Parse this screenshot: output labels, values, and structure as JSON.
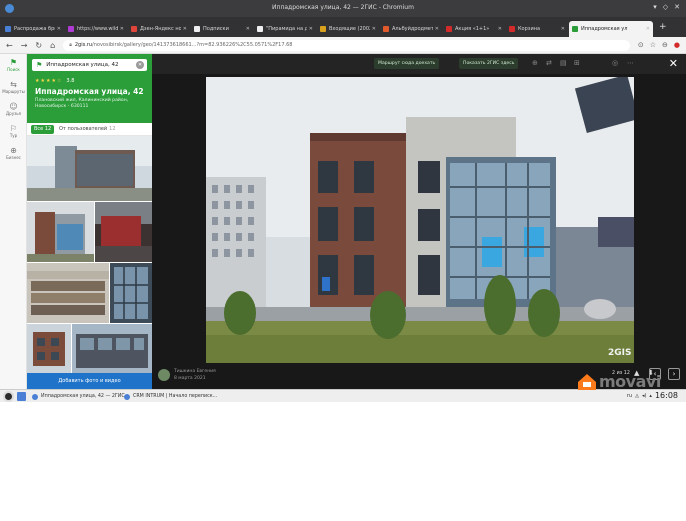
{
  "window": {
    "title": "Иппадромская улица, 42 — 2ГИС - Chromium"
  },
  "tabs": [
    {
      "label": "Распродажа брен",
      "color": "#4a7fd6"
    },
    {
      "label": "https://www.wildb",
      "color": "#b03ad4"
    },
    {
      "label": "Дзен-Яндекс новост",
      "color": "#e0443a"
    },
    {
      "label": "Подписки",
      "color": "#444444"
    },
    {
      "label": "\"Пирамида на до",
      "color": "#333333"
    },
    {
      "label": "Входящие (2002 н",
      "color": "#d9a21e"
    },
    {
      "label": "Альбуйдродмет",
      "color": "#e15a2c"
    },
    {
      "label": "Акция «1+1»",
      "color": "#d42a2a"
    },
    {
      "label": "Корзина",
      "color": "#d42a2a"
    },
    {
      "label": "Иппадромская ул",
      "color": "#2b9e3a",
      "active": true
    }
  ],
  "nav": {
    "host": "2gis.ru",
    "path": "/novosibirsk/gallery/geo/141373618661...",
    "query": "?m=82.936226%2C55.0571%2F17.68"
  },
  "rail": [
    {
      "label": "Поиск",
      "icon": "⚑",
      "selected": true
    },
    {
      "label": "Маршруты",
      "icon": "⇆"
    },
    {
      "label": "Друзья",
      "icon": "☺"
    },
    {
      "label": "Тур",
      "icon": "⚐"
    },
    {
      "label": "Бизнес",
      "icon": "⊕"
    }
  ],
  "panel": {
    "search_value": "Иппадромская улица, 42",
    "stars": "★★★★☆",
    "rating": "3.8",
    "name": "Иппадромская улица, 42",
    "address_line1": "Плановский жил, Калининский район,",
    "address_line2": "Новосибирск - 630111",
    "tab_all_label": "Все 12",
    "tab_user_label": "От пользователей",
    "tab_user_count": "12",
    "upload_label": "Добавить фото и видео"
  },
  "viewer": {
    "btn_route": "Маршрут сюда доехать",
    "btn_save": "Показать 2ГИС здесь",
    "author_name": "Тишкина Евгения",
    "author_date": "8 марта 2021",
    "counter": "2 из 12",
    "photo_sign": "2GIS"
  },
  "taskbar": {
    "task1": "Иппадромская улица, 42 — 2ГИС...",
    "task2": "CRM INTRUM | Начало переписк...",
    "lang": "ru",
    "clock": "16:08"
  },
  "watermark": {
    "text": "movavi"
  },
  "colors": {
    "accent": "#2b9e3a",
    "upload": "#1f73c9"
  }
}
